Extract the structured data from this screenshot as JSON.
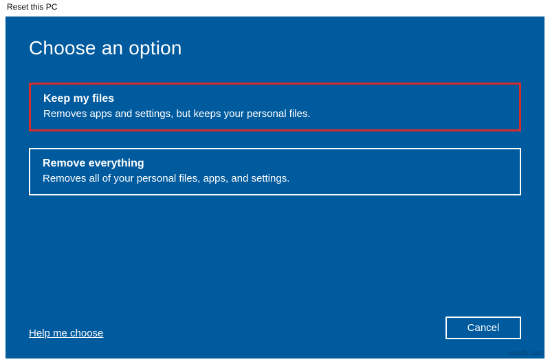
{
  "titlebar": {
    "title": "Reset this PC"
  },
  "heading": "Choose an option",
  "options": [
    {
      "title": "Keep my files",
      "description": "Removes apps and settings, but keeps your personal files.",
      "highlighted": true
    },
    {
      "title": "Remove everything",
      "description": "Removes all of your personal files, apps, and settings.",
      "highlighted": false
    }
  ],
  "footer": {
    "help_link": "Help me choose",
    "cancel_label": "Cancel"
  },
  "watermark": "wsxdn.com"
}
